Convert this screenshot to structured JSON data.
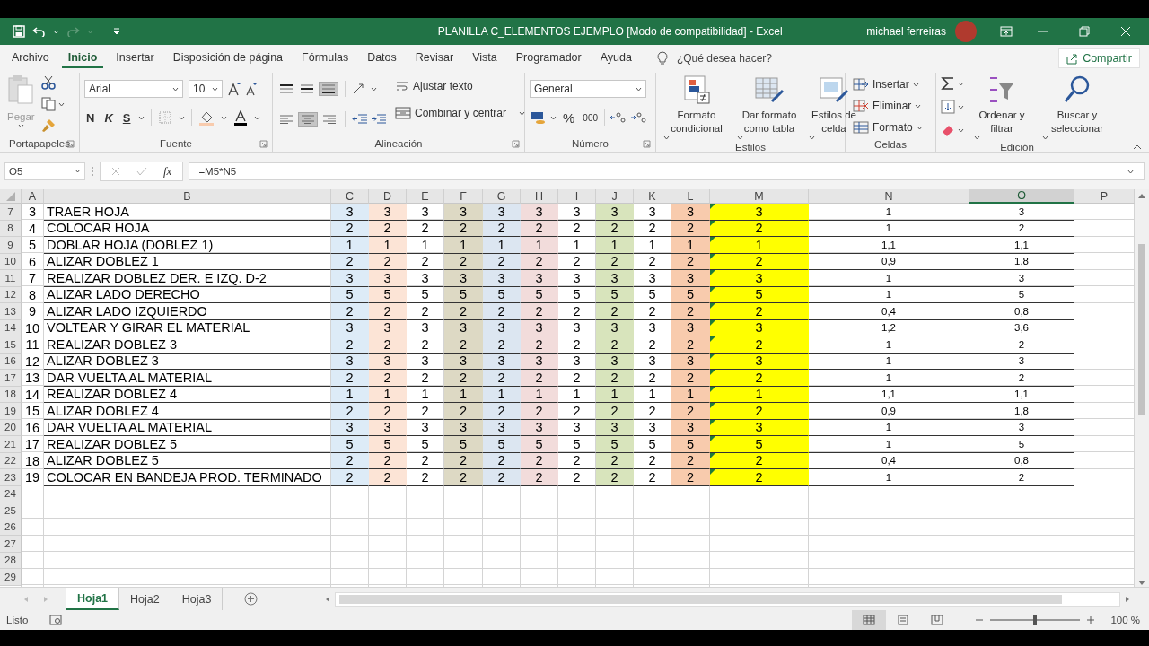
{
  "window": {
    "title": "PLANILLA C_ELEMENTOS EJEMPLO  [Modo de compatibilidad]  -  Excel",
    "user": "michael ferreiras"
  },
  "menu_tabs": [
    {
      "label": "Archivo",
      "selected": false
    },
    {
      "label": "Inicio",
      "selected": true
    },
    {
      "label": "Insertar",
      "selected": false
    },
    {
      "label": "Disposición de página",
      "selected": false
    },
    {
      "label": "Fórmulas",
      "selected": false
    },
    {
      "label": "Datos",
      "selected": false
    },
    {
      "label": "Revisar",
      "selected": false
    },
    {
      "label": "Vista",
      "selected": false
    },
    {
      "label": "Programador",
      "selected": false
    },
    {
      "label": "Ayuda",
      "selected": false
    }
  ],
  "tell_me": {
    "placeholder": "¿Qué desea hacer?"
  },
  "share_button": "Compartir",
  "ribbon": {
    "clipboard": {
      "paste": "Pegar",
      "group": "Portapapeles"
    },
    "font": {
      "name": "Arial",
      "size": "10",
      "bold": "N",
      "italic": "K",
      "underline": "S",
      "group": "Fuente"
    },
    "alignment": {
      "buttons": [
        {
          "selected": false
        },
        {
          "selected": false
        },
        {
          "selected": true
        },
        {
          "selected": false
        },
        {
          "selected": true
        },
        {
          "selected": false
        }
      ],
      "wrap": "Ajustar texto",
      "merge": "Combinar y centrar",
      "group": "Alineación"
    },
    "number": {
      "format": "General",
      "percent": "%",
      "thousands": "000",
      "group": "Número"
    },
    "styles": {
      "buttons": [
        "Formato condicional",
        "Dar formato como tabla",
        "Estilos de celda"
      ],
      "group": "Estilos"
    },
    "cells": {
      "buttons": [
        "Insertar",
        "Eliminar",
        "Formato"
      ],
      "group": "Celdas"
    },
    "editing": {
      "buttons": [
        "Ordenar y filtrar",
        "Buscar y seleccionar"
      ],
      "group": "Edición"
    }
  },
  "formula_bar": {
    "name_box": "O5",
    "fx": "fx",
    "formula": "=M5*N5"
  },
  "columns": [
    {
      "label": "A",
      "selected": false
    },
    {
      "label": "B",
      "selected": false
    },
    {
      "label": "C",
      "selected": false,
      "color": "#ddebf7"
    },
    {
      "label": "D",
      "selected": false,
      "color": "#fce4d6"
    },
    {
      "label": "E",
      "selected": false
    },
    {
      "label": "F",
      "selected": false,
      "color": "#ddd9c4"
    },
    {
      "label": "G",
      "selected": false,
      "color": "#dce6f1"
    },
    {
      "label": "H",
      "selected": false,
      "color": "#f2dcdb"
    },
    {
      "label": "I",
      "selected": false
    },
    {
      "label": "J",
      "selected": false,
      "color": "#d8e4bc"
    },
    {
      "label": "K",
      "selected": false
    },
    {
      "label": "L",
      "selected": false,
      "color": "#f8cbad"
    },
    {
      "label": "M",
      "selected": false,
      "color": "#ffff00"
    },
    {
      "label": "N",
      "selected": false
    },
    {
      "label": "O",
      "selected": true
    },
    {
      "label": "P",
      "selected": false
    }
  ],
  "rows": [
    {
      "num": "7",
      "cells": [
        "3",
        "TRAER HOJA",
        "3",
        "3",
        "3",
        "3",
        "3",
        "3",
        "3",
        "3",
        "3",
        "3",
        "3",
        "1",
        "3"
      ]
    },
    {
      "num": "8",
      "cells": [
        "4",
        "COLOCAR HOJA",
        "2",
        "2",
        "2",
        "2",
        "2",
        "2",
        "2",
        "2",
        "2",
        "2",
        "2",
        "1",
        "2"
      ]
    },
    {
      "num": "9",
      "cells": [
        "5",
        "DOBLAR HOJA (DOBLEZ 1)",
        "1",
        "1",
        "1",
        "1",
        "1",
        "1",
        "1",
        "1",
        "1",
        "1",
        "1",
        "1,1",
        "1,1"
      ]
    },
    {
      "num": "10",
      "cells": [
        "6",
        "ALIZAR DOBLEZ 1",
        "2",
        "2",
        "2",
        "2",
        "2",
        "2",
        "2",
        "2",
        "2",
        "2",
        "2",
        "0,9",
        "1,8"
      ]
    },
    {
      "num": "11",
      "cells": [
        "7",
        "REALIZAR DOBLEZ DER. E IZQ. D-2",
        "3",
        "3",
        "3",
        "3",
        "3",
        "3",
        "3",
        "3",
        "3",
        "3",
        "3",
        "1",
        "3"
      ]
    },
    {
      "num": "12",
      "cells": [
        "8",
        "ALIZAR LADO DERECHO",
        "5",
        "5",
        "5",
        "5",
        "5",
        "5",
        "5",
        "5",
        "5",
        "5",
        "5",
        "1",
        "5"
      ]
    },
    {
      "num": "13",
      "cells": [
        "9",
        "ALIZAR LADO IZQUIERDO",
        "2",
        "2",
        "2",
        "2",
        "2",
        "2",
        "2",
        "2",
        "2",
        "2",
        "2",
        "0,4",
        "0,8"
      ]
    },
    {
      "num": "14",
      "cells": [
        "10",
        "VOLTEAR Y GIRAR EL MATERIAL",
        "3",
        "3",
        "3",
        "3",
        "3",
        "3",
        "3",
        "3",
        "3",
        "3",
        "3",
        "1,2",
        "3,6"
      ]
    },
    {
      "num": "15",
      "cells": [
        "11",
        "REALIZAR DOBLEZ 3",
        "2",
        "2",
        "2",
        "2",
        "2",
        "2",
        "2",
        "2",
        "2",
        "2",
        "2",
        "1",
        "2"
      ]
    },
    {
      "num": "16",
      "cells": [
        "12",
        "ALIZAR DOBLEZ 3",
        "3",
        "3",
        "3",
        "3",
        "3",
        "3",
        "3",
        "3",
        "3",
        "3",
        "3",
        "1",
        "3"
      ]
    },
    {
      "num": "17",
      "cells": [
        "13",
        "DAR VUELTA AL MATERIAL",
        "2",
        "2",
        "2",
        "2",
        "2",
        "2",
        "2",
        "2",
        "2",
        "2",
        "2",
        "1",
        "2"
      ]
    },
    {
      "num": "18",
      "cells": [
        "14",
        "REALIZAR DOBLEZ 4",
        "1",
        "1",
        "1",
        "1",
        "1",
        "1",
        "1",
        "1",
        "1",
        "1",
        "1",
        "1,1",
        "1,1"
      ]
    },
    {
      "num": "19",
      "cells": [
        "15",
        "ALIZAR DOBLEZ 4",
        "2",
        "2",
        "2",
        "2",
        "2",
        "2",
        "2",
        "2",
        "2",
        "2",
        "2",
        "0,9",
        "1,8"
      ]
    },
    {
      "num": "20",
      "cells": [
        "16",
        "DAR VUELTA AL MATERIAL",
        "3",
        "3",
        "3",
        "3",
        "3",
        "3",
        "3",
        "3",
        "3",
        "3",
        "3",
        "1",
        "3"
      ]
    },
    {
      "num": "21",
      "cells": [
        "17",
        "REALIZAR DOBLEZ 5",
        "5",
        "5",
        "5",
        "5",
        "5",
        "5",
        "5",
        "5",
        "5",
        "5",
        "5",
        "1",
        "5"
      ]
    },
    {
      "num": "22",
      "cells": [
        "18",
        "ALIZAR DOBLEZ 5",
        "2",
        "2",
        "2",
        "2",
        "2",
        "2",
        "2",
        "2",
        "2",
        "2",
        "2",
        "0,4",
        "0,8"
      ]
    },
    {
      "num": "23",
      "cells": [
        "19",
        "COLOCAR EN BANDEJA PROD. TERMINADO",
        "2",
        "2",
        "2",
        "2",
        "2",
        "2",
        "2",
        "2",
        "2",
        "2",
        "2",
        "1",
        "2"
      ]
    },
    {
      "num": "24"
    },
    {
      "num": "25"
    },
    {
      "num": "26"
    },
    {
      "num": "27"
    },
    {
      "num": "28"
    },
    {
      "num": "29"
    }
  ],
  "sheet_tabs": [
    {
      "label": "Hoja1",
      "selected": true
    },
    {
      "label": "Hoja2",
      "selected": false
    },
    {
      "label": "Hoja3",
      "selected": false
    }
  ],
  "status_bar": {
    "status": "Listo",
    "views": [
      {
        "selected": true
      },
      {
        "selected": false
      },
      {
        "selected": false
      }
    ],
    "zoom": {
      "level": 0.5,
      "reading": "100 %"
    }
  }
}
